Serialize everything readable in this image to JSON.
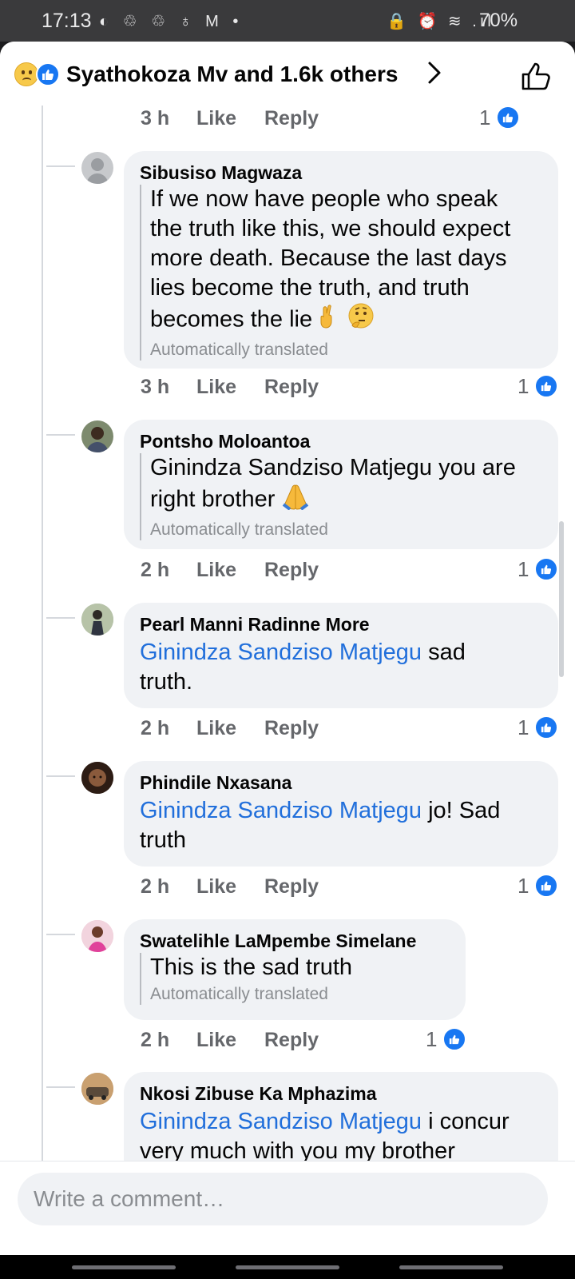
{
  "status_bar": {
    "time": "17:13",
    "left_icons": "◐ ♲ ♲ ♁ M •",
    "right_icons": "🔒 ⏰ ≋ .ıl",
    "battery": "70%"
  },
  "header": {
    "reactions": [
      "sad-reaction-icon",
      "like-reaction-icon"
    ],
    "title": "Syathokoza Mv and 1.6k others"
  },
  "top_meta": {
    "time": "3 h",
    "like": "Like",
    "reply": "Reply",
    "like_count": "1"
  },
  "comments": [
    {
      "author": "Sibusiso Magwaza",
      "text_lines": [
        "If we now have people who speak",
        "the truth like this, we should expect",
        "more death. Because the last days",
        "lies become the truth, and truth",
        "becomes the lie"
      ],
      "translated": "Automatically translated",
      "time": "3 h",
      "like": "Like",
      "reply": "Reply",
      "like_count": "1"
    },
    {
      "author": "Pontsho Moloantoa",
      "text_lines": [
        "Ginindza Sandziso Matjegu you are",
        "right brother"
      ],
      "translated": "Automatically translated",
      "time": "2 h",
      "like": "Like",
      "reply": "Reply",
      "like_count": "1"
    },
    {
      "author": "Pearl Manni Radinne More",
      "mention": "Ginindza Sandziso Matjegu",
      "text_rest": " sad",
      "text_line2": "truth.",
      "time": "2 h",
      "like": "Like",
      "reply": "Reply",
      "like_count": "1"
    },
    {
      "author": "Phindile Nxasana",
      "mention": "Ginindza Sandziso Matjegu",
      "text_rest": " jo! Sad",
      "text_line2": "truth",
      "time": "2 h",
      "like": "Like",
      "reply": "Reply",
      "like_count": "1"
    },
    {
      "author": "Swatelihle LaMpembe Simelane",
      "text_lines": [
        "This is the sad truth"
      ],
      "translated": "Automatically translated",
      "time": "2 h",
      "like": "Like",
      "reply": "Reply",
      "like_count": "1"
    },
    {
      "author": "Nkosi Zibuse Ka Mphazima",
      "mention": "Ginindza Sandziso Matjegu",
      "text_rest": " i concur",
      "text_line2": "very much with you my brother"
    }
  ],
  "composer": {
    "placeholder": "Write a comment…"
  },
  "colors": {
    "accent": "#1877f2",
    "mention": "#216fdb",
    "bubble": "#f0f2f5",
    "meta": "#65676b"
  }
}
